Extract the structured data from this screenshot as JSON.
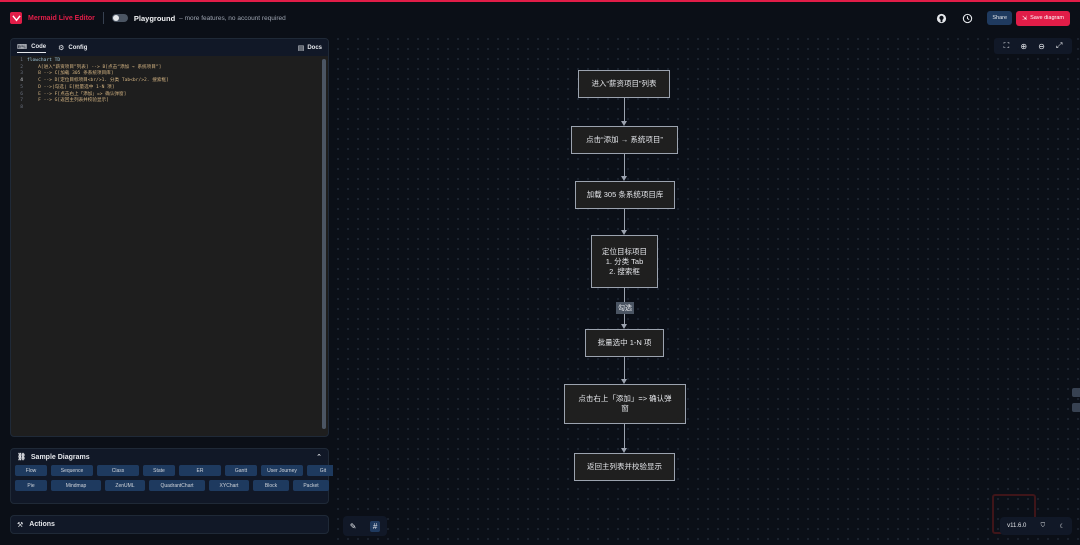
{
  "header": {
    "brand": "Mermaid Live Editor",
    "playground_title": "Playground",
    "playground_subtitle": "– more features, no account required",
    "share_label": "Share",
    "save_label": "Save diagram",
    "icons": [
      "github-icon",
      "history-icon"
    ]
  },
  "editor": {
    "tabs": [
      {
        "label": "Code",
        "icon": "code-icon",
        "active": true
      },
      {
        "label": "Config",
        "icon": "gear-icon",
        "active": false
      }
    ],
    "docs_label": "Docs",
    "lines": [
      {
        "n": "1",
        "text": "flowchart TD"
      },
      {
        "n": "2",
        "text": "    A[进入“薪资项目”列表] --> B[点击“添加 → 系统项目”]"
      },
      {
        "n": "3",
        "text": "    B --> C[加载 305 条系统项目库]"
      },
      {
        "n": "4",
        "text": "    C --> D[定位目标项目<br/>1. 分类 Tab<br/>2. 搜索框]"
      },
      {
        "n": "5",
        "text": "    D -->|勾选| E[批量选中 1-N 项]"
      },
      {
        "n": "6",
        "text": "    E --> F[点击右上「添加」=> 确认弹窗]"
      },
      {
        "n": "7",
        "text": "    F --> G[返回主列表并校验显示]"
      },
      {
        "n": "8",
        "text": ""
      }
    ]
  },
  "samples": {
    "title": "Sample Diagrams",
    "row1": [
      "Flow",
      "Sequence",
      "Class",
      "State",
      "ER",
      "Gantt",
      "User Journey",
      "Git"
    ],
    "row2": [
      "Pie",
      "Mindmap",
      "ZenUML",
      "QuadrantChart",
      "XYChart",
      "Block",
      "Packet"
    ]
  },
  "actions": {
    "title": "Actions"
  },
  "diagram": {
    "nodes": {
      "A": "进入“薪资项目”列表",
      "B": "点击“添加 → 系统项目”",
      "C": "加载 305 条系统项目库",
      "D1": "定位目标项目",
      "D2": "1. 分类 Tab",
      "D3": "2. 搜索框",
      "E": "批量选中 1-N 项",
      "F": "点击右上「添加」=> 确认弹窗",
      "G": "返回主列表并校验显示"
    },
    "edge_label": "勾选"
  },
  "footer": {
    "version": "v11.6.0"
  }
}
